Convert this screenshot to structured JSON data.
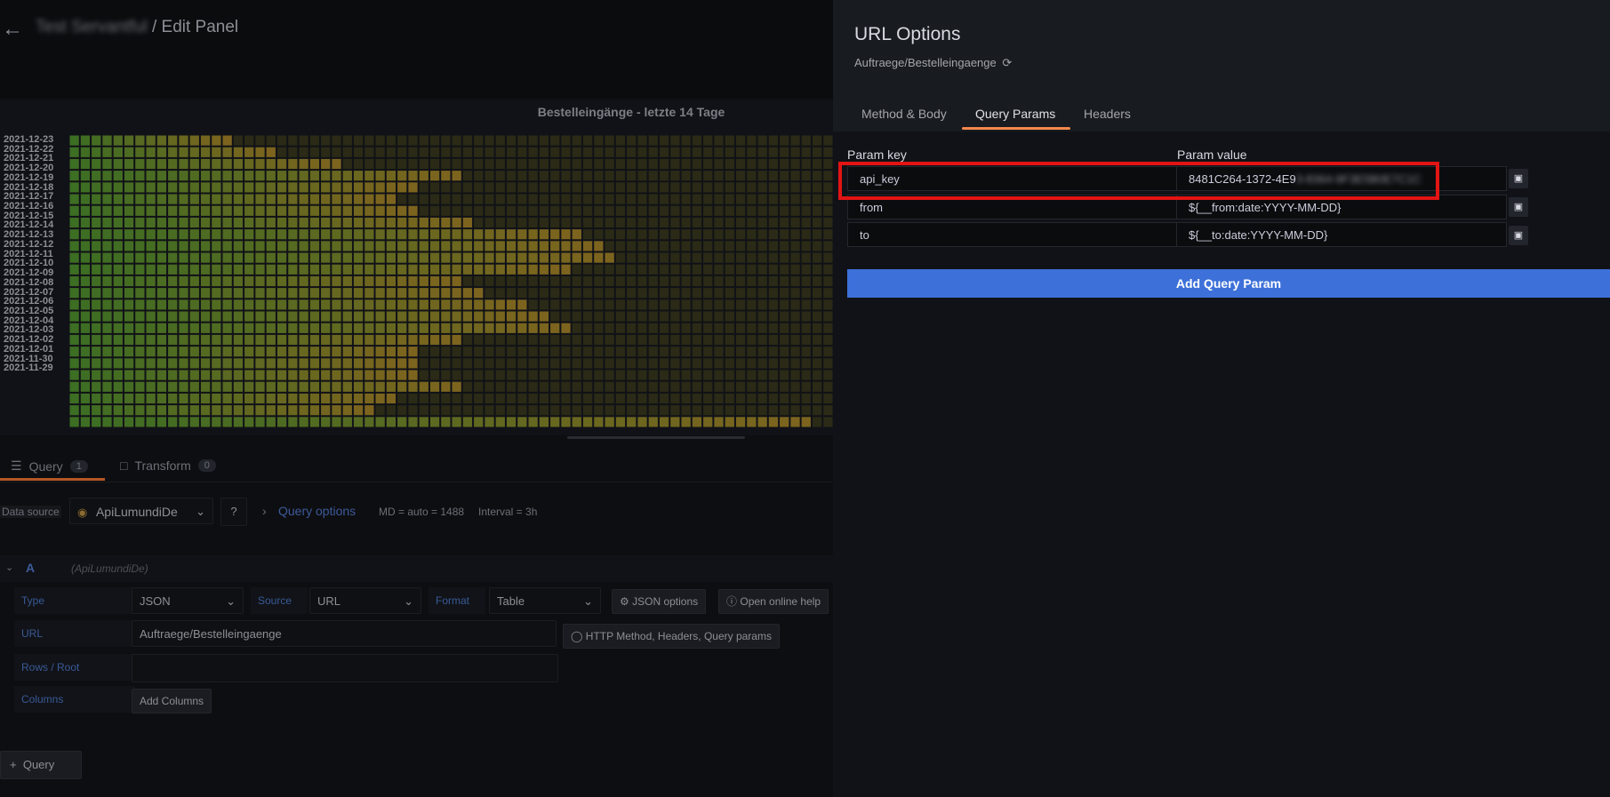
{
  "left": {
    "breadcrumb": {
      "dashboard": "Test Servantful",
      "separator": " / ",
      "page": "Edit Panel"
    },
    "panel": {
      "title": "Bestelleingänge - letzte 14 Tage",
      "dates": [
        "2021-12-23",
        "2021-12-22",
        "2021-12-21",
        "2021-12-20",
        "2021-12-19",
        "2021-12-18",
        "2021-12-17",
        "2021-12-16",
        "2021-12-15",
        "2021-12-14",
        "2021-12-13",
        "2021-12-12",
        "2021-12-11",
        "2021-12-10",
        "2021-12-09",
        "2021-12-08",
        "2021-12-07",
        "2021-12-06",
        "2021-12-05",
        "2021-12-04",
        "2021-12-03",
        "2021-12-02",
        "2021-12-01",
        "2021-11-30",
        "2021-11-29"
      ],
      "bright_counts": [
        15,
        19,
        25,
        36,
        32,
        30,
        32,
        37,
        47,
        49,
        50,
        46,
        36,
        38,
        42,
        44,
        46,
        36,
        32,
        32,
        32,
        36,
        30,
        28,
        68
      ]
    },
    "query_tabs": [
      {
        "label": "Query",
        "count": "1"
      },
      {
        "label": "Transform",
        "count": "0"
      }
    ],
    "datasource": {
      "label": "Data source",
      "value": "ApiLumundiDe",
      "query_options": "Query options",
      "md": "MD = auto = 1488",
      "interval": "Interval = 3h"
    },
    "query_a": {
      "letter": "A",
      "source_name": "(ApiLumundiDe)"
    },
    "fields": {
      "type_label": "Type",
      "type_value": "JSON",
      "source_label": "Source",
      "source_value": "URL",
      "format_label": "Format",
      "format_value": "Table",
      "json_options": "JSON options",
      "open_help": "Open online help",
      "url_label": "URL",
      "url_value": "Auftraege/Bestelleingaenge",
      "http_button": "HTTP Method, Headers, Query params",
      "rows_label": "Rows / Root",
      "columns_label": "Columns",
      "add_columns": "Add Columns"
    },
    "add_query": "Query"
  },
  "right": {
    "title": "URL Options",
    "subtitle": "Auftraege/Bestelleingaenge",
    "tabs": [
      "Method & Body",
      "Query Params",
      "Headers"
    ],
    "active_tab": "Query Params",
    "headers": {
      "key": "Param key",
      "value": "Param value"
    },
    "params": [
      {
        "key": "api_key",
        "value_visible": "8481C264-1372-4E9",
        "value_hidden": "3-8364-9F3E5B0E7C1C"
      },
      {
        "key": "from",
        "value_visible": "${__from:date:YYYY-MM-DD}",
        "value_hidden": ""
      },
      {
        "key": "to",
        "value_visible": "${__to:date:YYYY-MM-DD}",
        "value_hidden": ""
      }
    ],
    "add_button": "Add Query Param"
  }
}
